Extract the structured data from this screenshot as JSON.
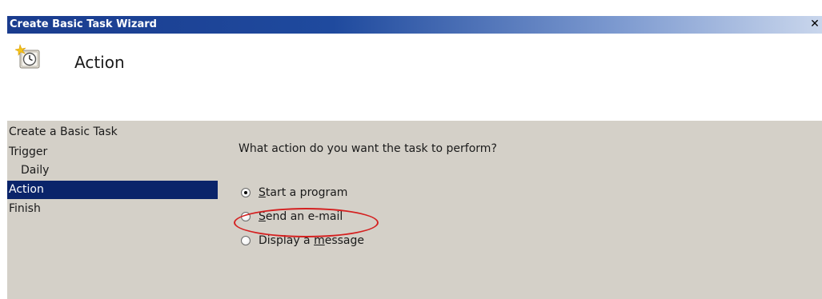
{
  "window": {
    "title": "Create Basic Task Wizard",
    "close_glyph": "✕"
  },
  "header": {
    "title": "Action",
    "icon": "scheduled-task-clock-icon"
  },
  "nav": {
    "items": [
      {
        "label": "Create a Basic Task",
        "selected": false,
        "sub": false
      },
      {
        "label": "Trigger",
        "selected": false,
        "sub": false
      },
      {
        "label": "Daily",
        "selected": false,
        "sub": true
      },
      {
        "label": "Action",
        "selected": true,
        "sub": false
      },
      {
        "label": "Finish",
        "selected": false,
        "sub": false
      }
    ]
  },
  "main": {
    "question": "What action do you want the task to perform?",
    "options": [
      {
        "pre": "",
        "mnemonic": "S",
        "post": "tart a program",
        "checked": true
      },
      {
        "pre": "",
        "mnemonic": "S",
        "post": "end an e-mail",
        "checked": false
      },
      {
        "pre": "Display a ",
        "mnemonic": "m",
        "post": "essage",
        "checked": false
      }
    ]
  },
  "colors": {
    "selection": "#0a246a",
    "panel": "#d4d0c8",
    "highlight_ring": "#d42020"
  }
}
